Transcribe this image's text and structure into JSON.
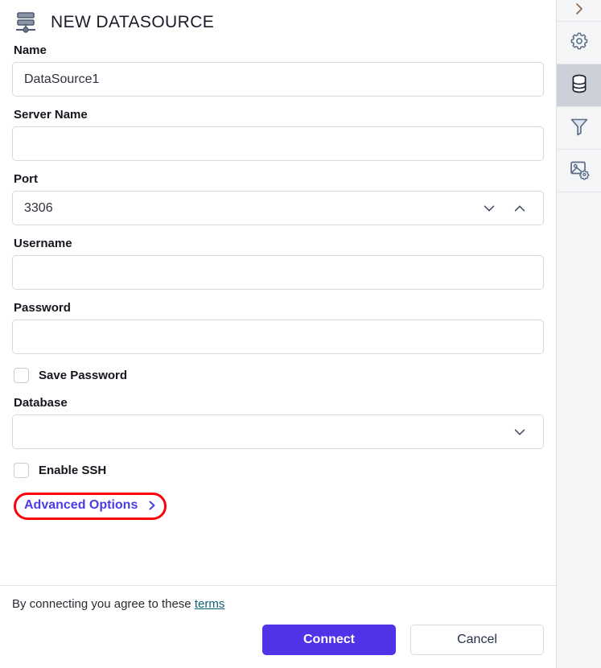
{
  "header": {
    "icon": "datasource-stack-icon",
    "title": "NEW DATASOURCE"
  },
  "form": {
    "fields": [
      {
        "label": "Name",
        "value": "DataSource1",
        "placeholder": "",
        "control": "text"
      },
      {
        "label": "Server Name",
        "value": "",
        "placeholder": "",
        "control": "text"
      },
      {
        "label": "Port",
        "value": "3306",
        "placeholder": "",
        "control": "spinner"
      },
      {
        "label": "Username",
        "value": "",
        "placeholder": "",
        "control": "text"
      },
      {
        "label": "Password",
        "value": "",
        "placeholder": "",
        "control": "password"
      }
    ],
    "save_password": {
      "label": "Save Password",
      "checked": false
    },
    "database": {
      "label": "Database",
      "value": "",
      "placeholder": "",
      "control": "select"
    },
    "enable_ssh": {
      "label": "Enable SSH",
      "checked": false
    },
    "advanced_options": {
      "label": "Advanced Options",
      "chevron": "chevron-right-icon",
      "highlighted": true,
      "highlight_color": "#fb0007"
    }
  },
  "footer": {
    "terms_text": "By connecting you agree to these",
    "terms_link": "terms",
    "connect_label": "Connect",
    "cancel_label": "Cancel"
  },
  "rail": {
    "items": [
      {
        "name": "expand-panel-icon",
        "icon": "chevron-right-icon",
        "selected": false
      },
      {
        "name": "settings-icon",
        "icon": "gear-icon",
        "selected": false
      },
      {
        "name": "datasource-icon",
        "icon": "database-icon",
        "selected": true
      },
      {
        "name": "filter-icon",
        "icon": "funnel-icon",
        "selected": false
      },
      {
        "name": "image-settings-icon",
        "icon": "image-gear-icon",
        "selected": false
      }
    ]
  },
  "colors": {
    "accent": "#5232e8",
    "link": "#4b3de2",
    "terms_link": "#0f5e77",
    "highlight": "#fb0007",
    "icon_outline": "#5a6b85",
    "rail_selected_bg": "#ccd0d9"
  }
}
